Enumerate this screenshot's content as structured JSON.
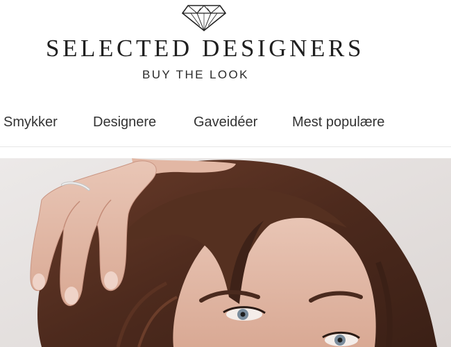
{
  "header": {
    "brand_name": "SELECTED DESIGNERS",
    "tagline": "BUY THE LOOK",
    "logo_icon": "diamond-icon"
  },
  "nav": {
    "items": [
      {
        "label": "Smykker"
      },
      {
        "label": "Designere"
      },
      {
        "label": "Gaveidéer"
      },
      {
        "label": "Mest populære"
      }
    ]
  },
  "hero": {
    "image": "hero-portrait"
  },
  "colors": {
    "text": "#1f1f1f",
    "nav_text": "#333333",
    "divider": "#e6e6e6",
    "hero_background": "#e8e4e3"
  }
}
